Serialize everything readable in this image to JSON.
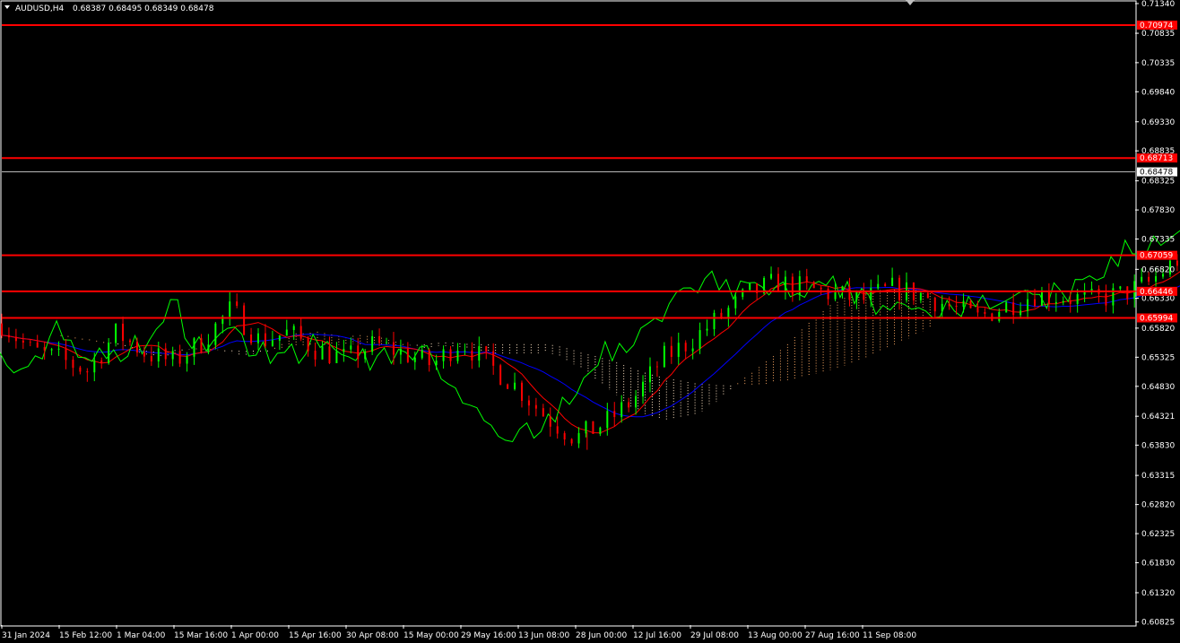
{
  "header": {
    "symbol": "AUDUSD,H4",
    "ohlc": "0.68387 0.68495 0.68349 0.68478"
  },
  "colors": {
    "background": "#000000",
    "axis": "#ffffff",
    "level_line": "#ff0000",
    "level_label_bg": "#ff0000",
    "current_label_bg": "#ffffff",
    "bull_candle": "#00ff00",
    "bear_candle": "#ff0000",
    "chikou_span": "#00ff00",
    "kijun_sen": "#0000ff",
    "tenkan_sen": "#ff0000",
    "cloud_a": "#f4a460",
    "cloud_b": "#ffe4c4"
  },
  "chart_data": {
    "type": "candlestick",
    "title": "AUDUSD,H4",
    "y_ticks": [
      "0.71340",
      "0.70835",
      "0.70335",
      "0.69840",
      "0.69330",
      "0.68835",
      "0.68325",
      "0.67830",
      "0.67335",
      "0.66820",
      "0.66330",
      "0.65820",
      "0.65325",
      "0.64830",
      "0.64321",
      "0.63830",
      "0.63315",
      "0.62820",
      "0.62325",
      "0.61830",
      "0.61320",
      "0.60825"
    ],
    "ylim": [
      0.6077,
      0.7137
    ],
    "x_ticks": [
      "31 Jan 2024",
      "15 Feb 12:00",
      "1 Mar 04:00",
      "15 Mar 16:00",
      "1 Apr 00:00",
      "15 Apr 16:00",
      "30 Apr 08:00",
      "15 May 00:00",
      "29 May 16:00",
      "13 Jun 08:00",
      "28 Jun 00:00",
      "12 Jul 16:00",
      "29 Jul 08:00",
      "13 Aug 00:00",
      "27 Aug 16:00",
      "11 Sep 08:00"
    ],
    "levels": [
      {
        "value": 0.70974,
        "label": "0.70974"
      },
      {
        "value": 0.68713,
        "label": "0.68713"
      },
      {
        "value": 0.67059,
        "label": "0.67059"
      },
      {
        "value": 0.66446,
        "label": "0.66446"
      },
      {
        "value": 0.65994,
        "label": "0.65994"
      }
    ],
    "current_price": {
      "value": 0.68478,
      "label": "0.68478"
    },
    "close_path": [
      [
        0,
        0.659
      ],
      [
        0.5,
        0.6545
      ],
      [
        1,
        0.653
      ],
      [
        1.5,
        0.651
      ],
      [
        2,
        0.6575
      ],
      [
        2.5,
        0.654
      ],
      [
        3,
        0.6525
      ],
      [
        3.5,
        0.656
      ],
      [
        4,
        0.6615
      ],
      [
        4.5,
        0.656
      ],
      [
        5,
        0.6575
      ],
      [
        5.5,
        0.6545
      ],
      [
        6,
        0.653
      ],
      [
        6.5,
        0.6555
      ],
      [
        7,
        0.654
      ],
      [
        7.5,
        0.652
      ],
      [
        8,
        0.656
      ],
      [
        8.5,
        0.652
      ],
      [
        9,
        0.648
      ],
      [
        9.5,
        0.643
      ],
      [
        10,
        0.6395
      ],
      [
        10.5,
        0.642
      ],
      [
        11,
        0.646
      ],
      [
        11.5,
        0.653
      ],
      [
        12,
        0.656
      ],
      [
        12.5,
        0.66
      ],
      [
        13,
        0.664
      ],
      [
        13.5,
        0.666
      ],
      [
        14,
        0.665
      ],
      [
        14.5,
        0.664
      ],
      [
        15,
        0.663
      ],
      [
        15.5,
        0.665
      ],
      [
        16,
        0.664
      ],
      [
        16.5,
        0.662
      ],
      [
        17,
        0.66
      ],
      [
        17.5,
        0.662
      ],
      [
        18,
        0.664
      ],
      [
        18.5,
        0.6635
      ],
      [
        19,
        0.663
      ],
      [
        19.5,
        0.664
      ],
      [
        20,
        0.666
      ],
      [
        20.5,
        0.67
      ],
      [
        21,
        0.672
      ],
      [
        21.5,
        0.6745
      ],
      [
        22,
        0.677
      ],
      [
        22.5,
        0.6745
      ],
      [
        23,
        0.672
      ],
      [
        23.5,
        0.669
      ],
      [
        24,
        0.6655
      ],
      [
        24.5,
        0.661
      ],
      [
        25,
        0.656
      ],
      [
        25.5,
        0.653
      ],
      [
        26,
        0.651
      ],
      [
        26.5,
        0.6475
      ],
      [
        27,
        0.652
      ],
      [
        27.5,
        0.656
      ],
      [
        28,
        0.66
      ],
      [
        28.5,
        0.666
      ],
      [
        29,
        0.672
      ],
      [
        29.5,
        0.6745
      ],
      [
        30,
        0.673
      ],
      [
        30.5,
        0.67
      ],
      [
        31,
        0.673
      ],
      [
        31.5,
        0.676
      ],
      [
        32,
        0.674
      ],
      [
        32.5,
        0.671
      ],
      [
        33,
        0.666
      ],
      [
        33.5,
        0.668
      ],
      [
        34,
        0.672
      ],
      [
        34.5,
        0.676
      ],
      [
        35,
        0.68
      ],
      [
        35.5,
        0.683
      ],
      [
        36,
        0.6848
      ]
    ],
    "spikes": [
      [
        10.2,
        0.6375
      ],
      [
        26.4,
        0.635
      ]
    ],
    "ichimoku": {
      "tenkan_sen": "red",
      "kijun_sen": "blue",
      "chikou_span": "green",
      "cloud": "dotted"
    }
  }
}
